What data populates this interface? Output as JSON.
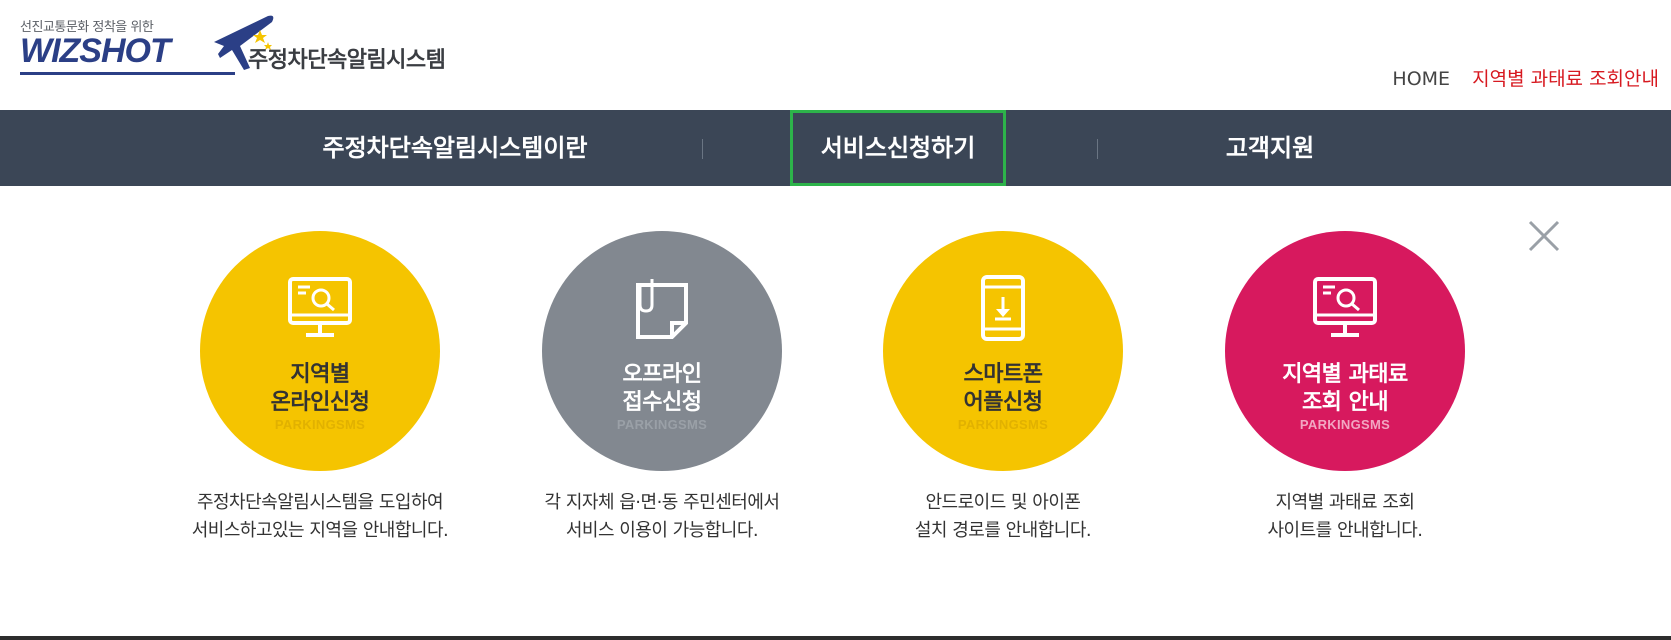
{
  "header": {
    "logo_tagline": "선진교통문화 정착을 위한",
    "logo_word": "WIZSHOT",
    "logo_title": "주정차단속알림시스템",
    "util_home": "HOME",
    "util_fee": "지역별 과태료 조회안내"
  },
  "nav": {
    "items": [
      {
        "label": "주정차단속알림시스템이란"
      },
      {
        "label": "서비스신청하기"
      },
      {
        "label": "고객지원"
      }
    ]
  },
  "colors": {
    "nav_bg": "#3b4656",
    "active_outline": "#2db34a",
    "yellow": "#f5c400",
    "gray": "#828890",
    "pink": "#d7195e",
    "alert_red": "#d71920"
  },
  "cards": [
    {
      "icon": "monitor-search-icon",
      "title1": "지역별",
      "title2": "온라인신청",
      "sub": "PARKINGSMS",
      "desc1": "주정차단속알림시스템을 도입하여",
      "desc2": "서비스하고있는 지역을 안내합니다."
    },
    {
      "icon": "document-clip-icon",
      "title1": "오프라인",
      "title2": "접수신청",
      "sub": "PARKINGSMS",
      "desc1": "각 지자체 읍·면·동 주민센터에서",
      "desc2": "서비스 이용이 가능합니다."
    },
    {
      "icon": "smartphone-download-icon",
      "title1": "스마트폰",
      "title2": "어플신청",
      "sub": "PARKINGSMS",
      "desc1": "안드로이드 및 아이폰",
      "desc2": "설치 경로를 안내합니다."
    },
    {
      "icon": "monitor-search-icon",
      "title1": "지역별 과태료",
      "title2": "조회 안내",
      "sub": "PARKINGSMS",
      "desc1": "지역별 과태료 조회",
      "desc2": "사이트를 안내합니다."
    }
  ]
}
